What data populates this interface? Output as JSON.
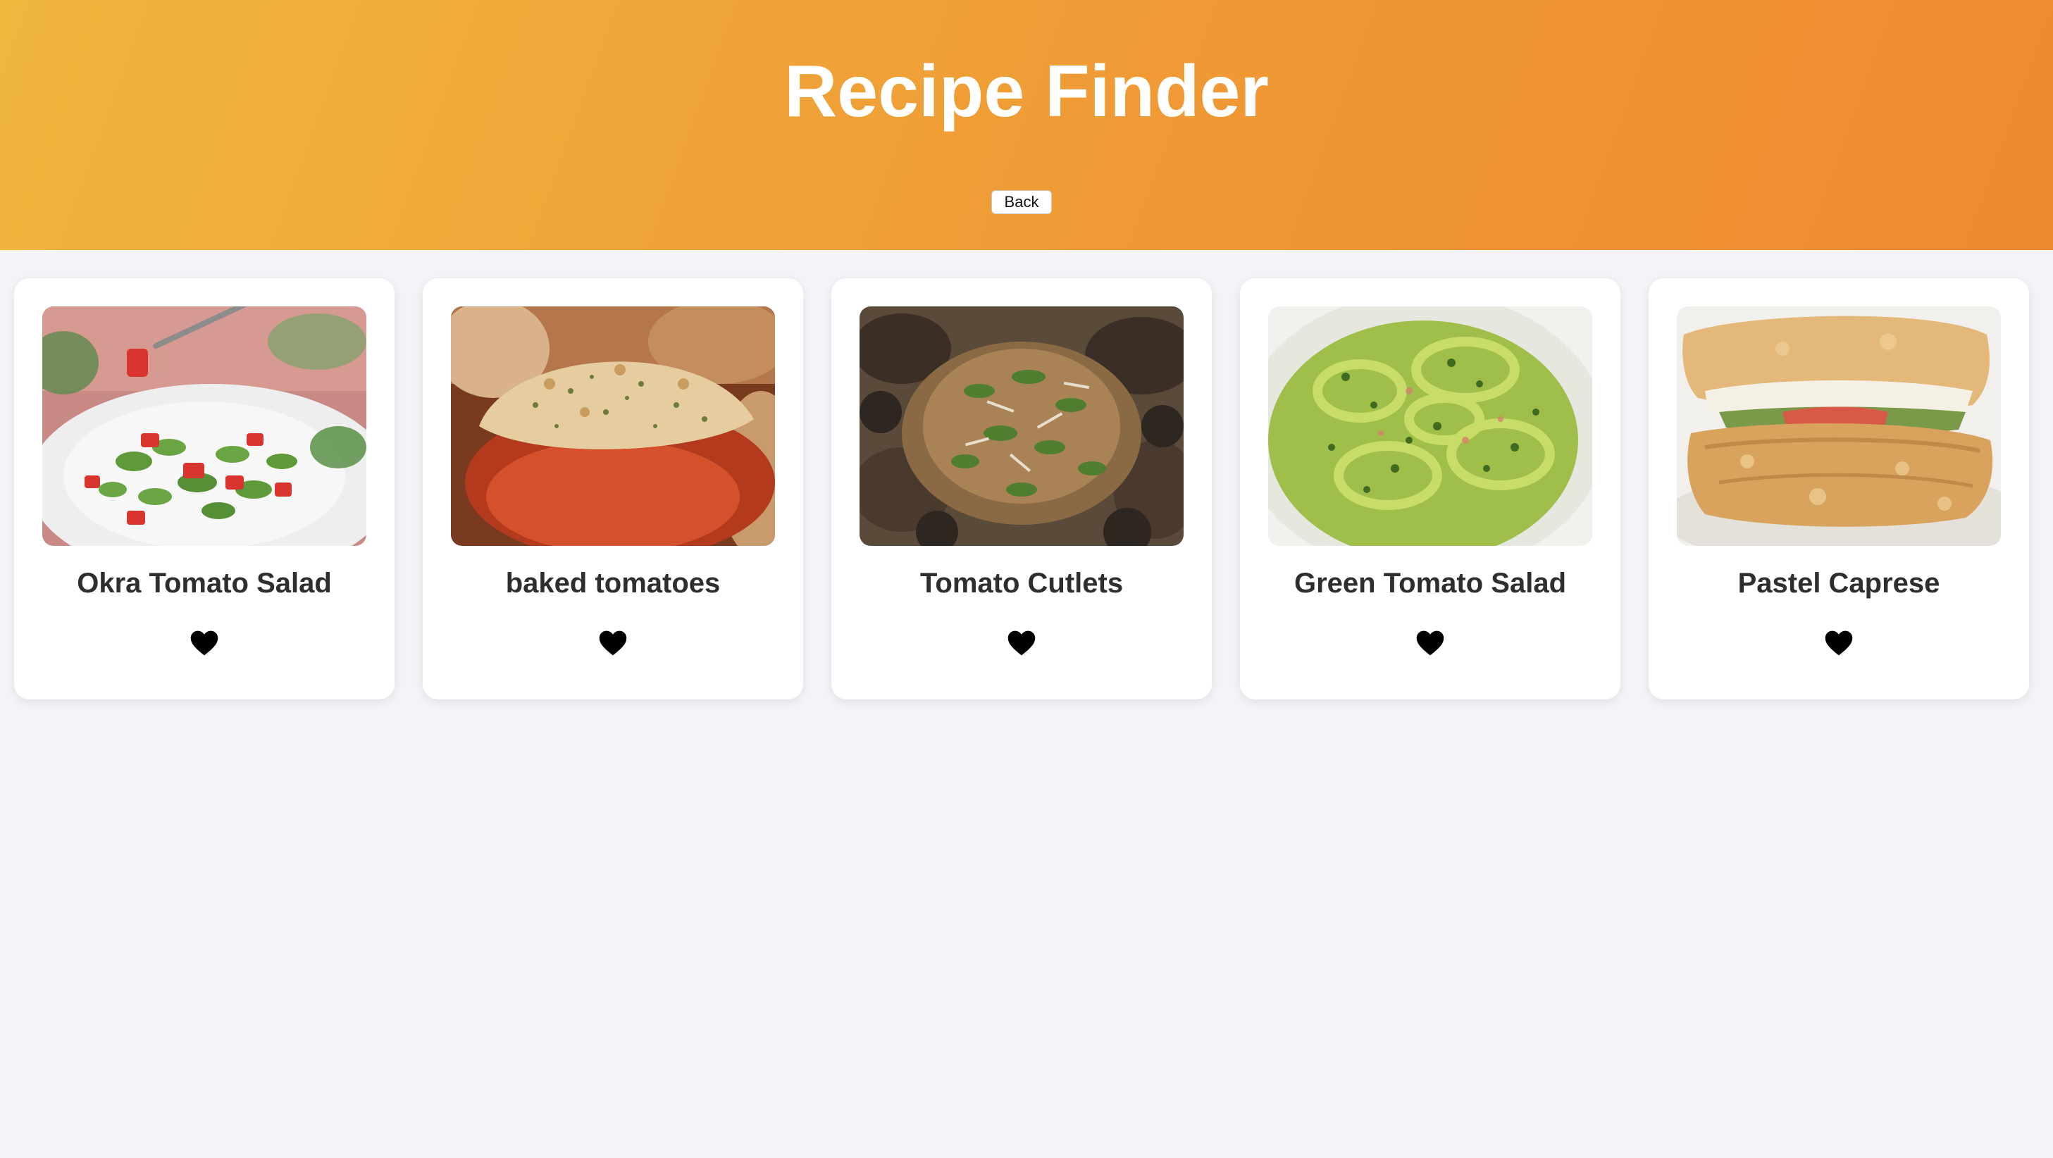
{
  "header": {
    "title": "Recipe Finder",
    "back_label": "Back"
  },
  "recipes": [
    {
      "title": "Okra Tomato Salad",
      "image": "okra-tomato-salad-photo",
      "favorite_icon": "heart-icon"
    },
    {
      "title": "baked tomatoes",
      "image": "baked-tomatoes-photo",
      "favorite_icon": "heart-icon"
    },
    {
      "title": "Tomato Cutlets",
      "image": "tomato-cutlets-photo",
      "favorite_icon": "heart-icon"
    },
    {
      "title": "Green Tomato Salad",
      "image": "green-tomato-salad-photo",
      "favorite_icon": "heart-icon"
    },
    {
      "title": "Pastel Caprese",
      "image": "pastel-caprese-photo",
      "favorite_icon": "heart-icon"
    }
  ],
  "colors": {
    "header_gradient_start": "#f0b63e",
    "header_gradient_end": "#ef8931",
    "page_background": "#f3f3f8",
    "card_background": "#ffffff",
    "title_text": "#ffffff",
    "card_title_text": "#2e2e2e",
    "heart": "#000000"
  }
}
